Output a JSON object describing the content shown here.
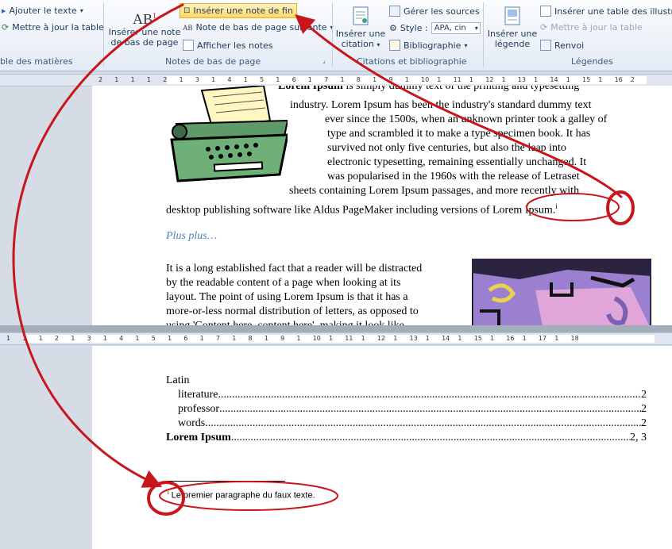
{
  "ribbon": {
    "toc_group": {
      "add_text": "Ajouter le texte",
      "update_table": "Mettre à jour la table",
      "label": "ble des matières"
    },
    "footnotes_group": {
      "insert_footnote_line1": "Insérer une note",
      "insert_footnote_line2": "de bas de page",
      "insert_endnote": "Insérer une note de fin",
      "next_footnote": "Note de bas de page suivante",
      "show_notes": "Afficher les notes",
      "label": "Notes de bas de page"
    },
    "citations_group": {
      "insert_citation_line1": "Insérer une",
      "insert_citation_line2": "citation",
      "manage_sources": "Gérer les sources",
      "style_label": "Style :",
      "style_value": "APA, cin",
      "bibliography": "Bibliographie",
      "label": "Citations et bibliographie"
    },
    "captions_group": {
      "insert_caption_line1": "Insérer une",
      "insert_caption_line2": "légende",
      "insert_table_figures": "Insérer une table des illustrati",
      "update_table": "Mettre à jour la table",
      "cross_reference": "Renvoi",
      "label": "Légendes"
    }
  },
  "ruler_top": {
    "left": [
      "2",
      "1",
      "1",
      "1",
      "2",
      "1",
      "3",
      "1",
      "4",
      "1",
      "5",
      "1",
      "6",
      "1",
      "7",
      "1",
      "8",
      "1",
      "9",
      "1",
      "10",
      "1",
      "11",
      "1",
      "12",
      "1",
      "13",
      "1",
      "14",
      "1",
      "15",
      "1",
      "16",
      "2"
    ]
  },
  "ruler_bottom": {
    "ticks": [
      "1",
      "1",
      "1",
      "2",
      "1",
      "3",
      "1",
      "4",
      "1",
      "5",
      "1",
      "6",
      "1",
      "7",
      "1",
      "8",
      "1",
      "9",
      "1",
      "10",
      "1",
      "11",
      "1",
      "12",
      "1",
      "13",
      "1",
      "14",
      "1",
      "15",
      "1",
      "16",
      "1",
      "17",
      "1",
      "18"
    ]
  },
  "document": {
    "body_lines": [
      "Lorem Ipsum is simply dummy text of the printing and typesetting",
      "industry. Lorem Ipsum has been the industry's standard dummy text",
      "ever since the 1500s, when an unknown printer took a galley of",
      "type and scrambled it to make a type specimen book. It has",
      "survived not only five centuries, but also the leap into",
      "electronic typesetting, remaining essentially unchanged. It",
      "was popularised in the 1960s with the release of Letraset",
      "sheets containing Lorem Ipsum passages, and more recently with",
      "desktop publishing software like Aldus PageMaker including versions of Lorem Ipsum."
    ],
    "footnote_ref": "i",
    "heading": "Plus plus…",
    "para2_lines": [
      "It is a long established fact that a reader will be distracted",
      "by the readable content of a page when looking at its",
      "layout. The point of using Lorem Ipsum is that it has a",
      "more-or-less  normal distribution of letters, as opposed to",
      "using 'Content here, content here', making it look like"
    ],
    "index": [
      {
        "term": "Latin",
        "page": "",
        "level": 0,
        "bold": false
      },
      {
        "term": "literature",
        "page": "2",
        "level": 1,
        "bold": false
      },
      {
        "term": "professor",
        "page": "2",
        "level": 1,
        "bold": false
      },
      {
        "term": "words",
        "page": "2",
        "level": 1,
        "bold": false
      },
      {
        "term": "Lorem Ipsum",
        "page": "2, 3",
        "level": 0,
        "bold": true
      }
    ],
    "footnote_marker": "i",
    "footnote_text": "Le premier paragraphe du faux texte."
  },
  "colors": {
    "annotation_red": "#c8161d",
    "heading_blue": "#4f81bd",
    "ribbon_text": "#1e395b"
  }
}
